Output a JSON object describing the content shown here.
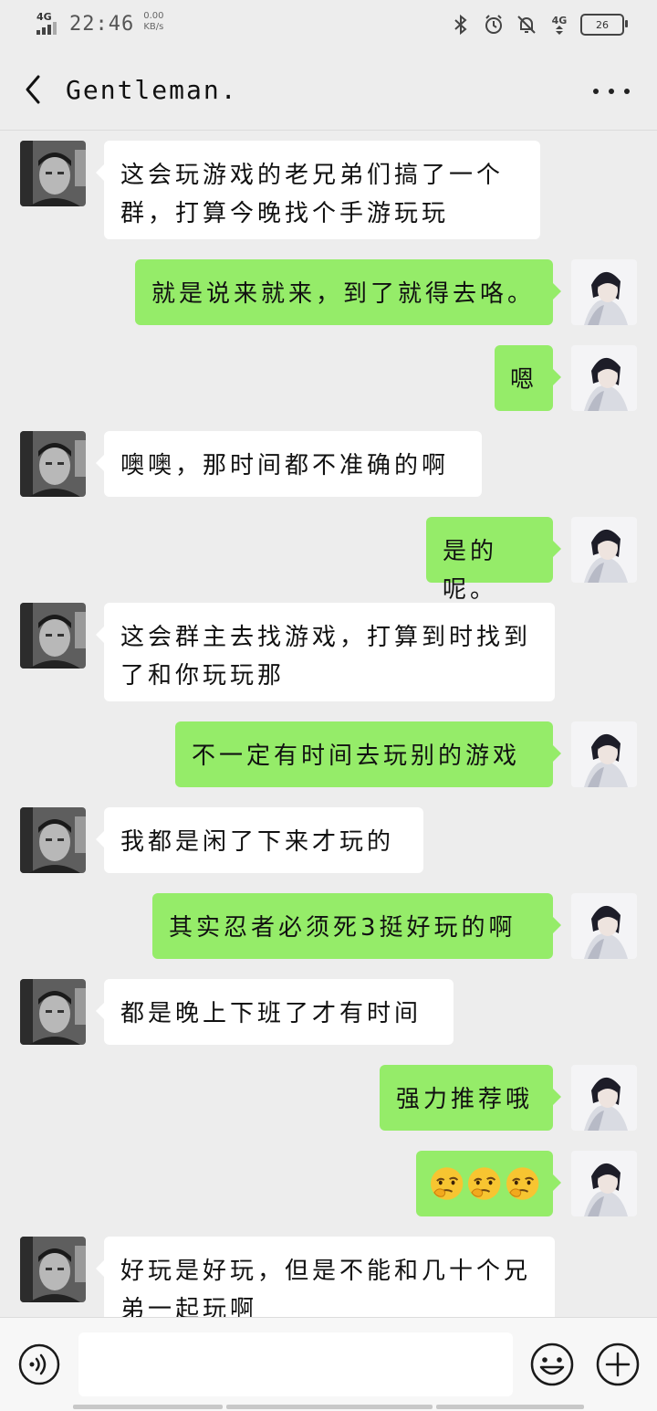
{
  "status_bar": {
    "network": "4G",
    "time": "22:46",
    "speed_value": "0.00",
    "speed_unit": "KB/s",
    "net_right": "4G",
    "battery": "26"
  },
  "header": {
    "title": "Gentleman."
  },
  "messages": [
    {
      "side": "left",
      "text": "这会玩游戏的老兄弟们搞了一个群，打算今晚找个手游玩玩"
    },
    {
      "side": "right",
      "text": "就是说来就来，到了就得去咯。"
    },
    {
      "side": "right",
      "text": "嗯"
    },
    {
      "side": "left",
      "text": "噢噢，那时间都不准确的啊"
    },
    {
      "side": "right",
      "text": "是的呢。"
    },
    {
      "side": "left",
      "text": "这会群主去找游戏，打算到时找到了和你玩玩那"
    },
    {
      "side": "right",
      "text": "不一定有时间去玩别的游戏"
    },
    {
      "side": "left",
      "text": "我都是闲了下来才玩的"
    },
    {
      "side": "right",
      "text": "其实忍者必须死3挺好玩的啊"
    },
    {
      "side": "left",
      "text": "都是晚上下班了才有时间"
    },
    {
      "side": "right",
      "text": "强力推荐哦"
    },
    {
      "side": "right",
      "emoji": [
        "thinking-face",
        "thinking-face",
        "thinking-face"
      ]
    },
    {
      "side": "left",
      "text": "好玩是好玩，但是不能和几十个兄弟一起玩啊"
    }
  ],
  "input": {
    "value": "",
    "placeholder": ""
  },
  "colors": {
    "background": "#ededed",
    "outgoing_bubble": "#95ec69",
    "incoming_bubble": "#ffffff"
  },
  "icons": {
    "back": "chevron-left-icon",
    "more": "more-dots-icon",
    "voice": "voice-icon",
    "emoji": "emoji-icon",
    "plus": "plus-icon"
  }
}
